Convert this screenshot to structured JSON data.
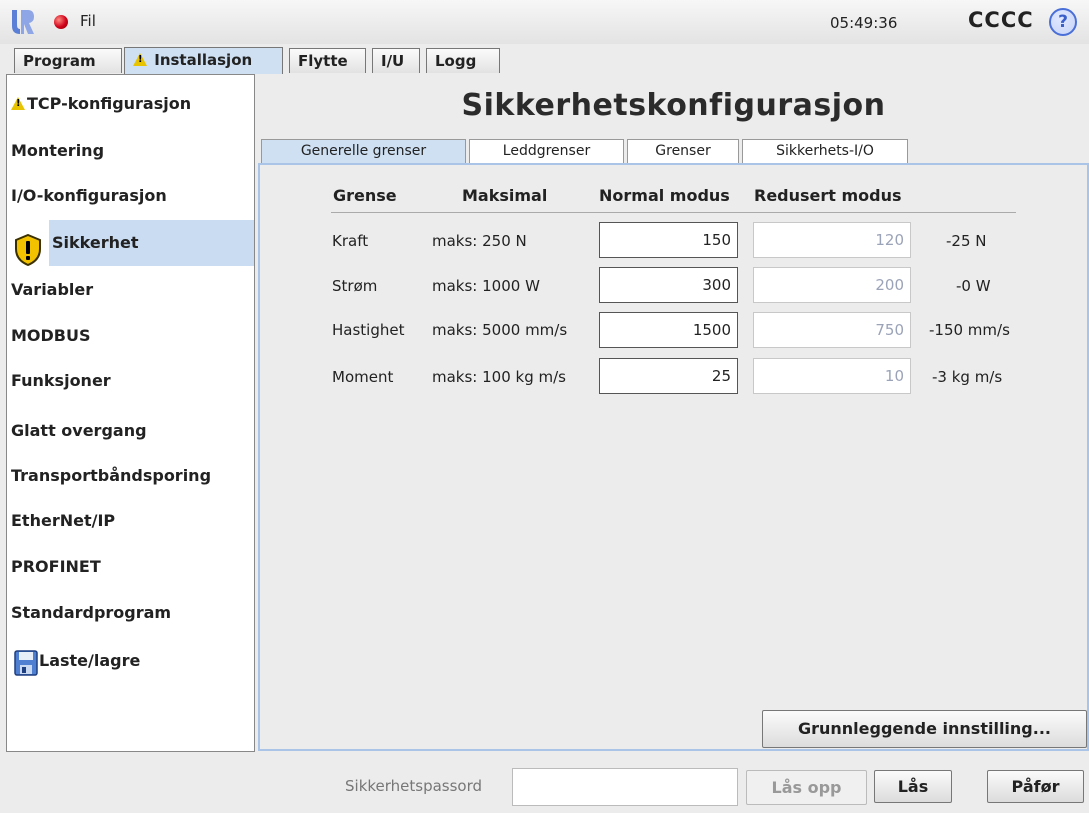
{
  "topbar": {
    "file_label": "Fil",
    "time": "05:49:36",
    "robot_name": "CCCC",
    "help_glyph": "?",
    "icons": [
      "ur-logo-icon",
      "status-dot-icon",
      "help-icon"
    ],
    "status_color": "#d0021b"
  },
  "main_tabs": [
    {
      "label": "Program"
    },
    {
      "label": "Installasjon",
      "warning": true,
      "active": true
    },
    {
      "label": "Flytte"
    },
    {
      "label": "I/U"
    },
    {
      "label": "Logg"
    }
  ],
  "sidebar": {
    "items": [
      {
        "label": "TCP-konfigurasjon",
        "warning": true
      },
      {
        "label": "Montering"
      },
      {
        "label": "I/O-konfigurasjon"
      },
      {
        "label": "Sikkerhet",
        "selected": true,
        "icon": "shield-warning-icon"
      },
      {
        "label": "Variabler"
      },
      {
        "label": "MODBUS"
      },
      {
        "label": "Funksjoner"
      },
      {
        "label": "Glatt overgang"
      },
      {
        "label": "Transportbåndsporing"
      },
      {
        "label": "EtherNet/IP"
      },
      {
        "label": "PROFINET"
      },
      {
        "label": "Standardprogram"
      },
      {
        "label": "Laste/lagre",
        "icon": "floppy-disk-icon"
      }
    ]
  },
  "main": {
    "title": "Sikkerhetskonfigurasjon",
    "sub_tabs": [
      {
        "label": "Generelle grenser",
        "active": true
      },
      {
        "label": "Leddgrenser"
      },
      {
        "label": "Grenser"
      },
      {
        "label": "Sikkerhets-I/O"
      }
    ],
    "headers": {
      "limit": "Grense",
      "max": "Maksimal",
      "normal": "Normal modus",
      "reduced": "Redusert modus"
    },
    "rows": [
      {
        "name": "Kraft",
        "max": "maks: 250 N",
        "normal": "150",
        "reduced": "120",
        "diff": "-25 N"
      },
      {
        "name": "Strøm",
        "max": "maks: 1000 W",
        "normal": "300",
        "reduced": "200",
        "diff": "-0 W"
      },
      {
        "name": "Hastighet",
        "max": "maks: 5000 mm/s",
        "normal": "1500",
        "reduced": "750",
        "diff": "-150 mm/s"
      },
      {
        "name": "Moment",
        "max": "maks: 100 kg m/s",
        "normal": "25",
        "reduced": "10",
        "diff": "-3 kg m/s"
      }
    ],
    "basic_settings_button": "Grunnleggende innstilling..."
  },
  "bottom": {
    "password_label": "Sikkerhetspassord",
    "password_value": "",
    "unlock_button": "Lås opp",
    "lock_button": "Lås",
    "apply_button": "Påfør"
  },
  "colors": {
    "accent": "#cfe0f3",
    "panel_border": "#a9c4e6",
    "warning": "#e8c400",
    "reduced_text": "#9ba3b8"
  }
}
